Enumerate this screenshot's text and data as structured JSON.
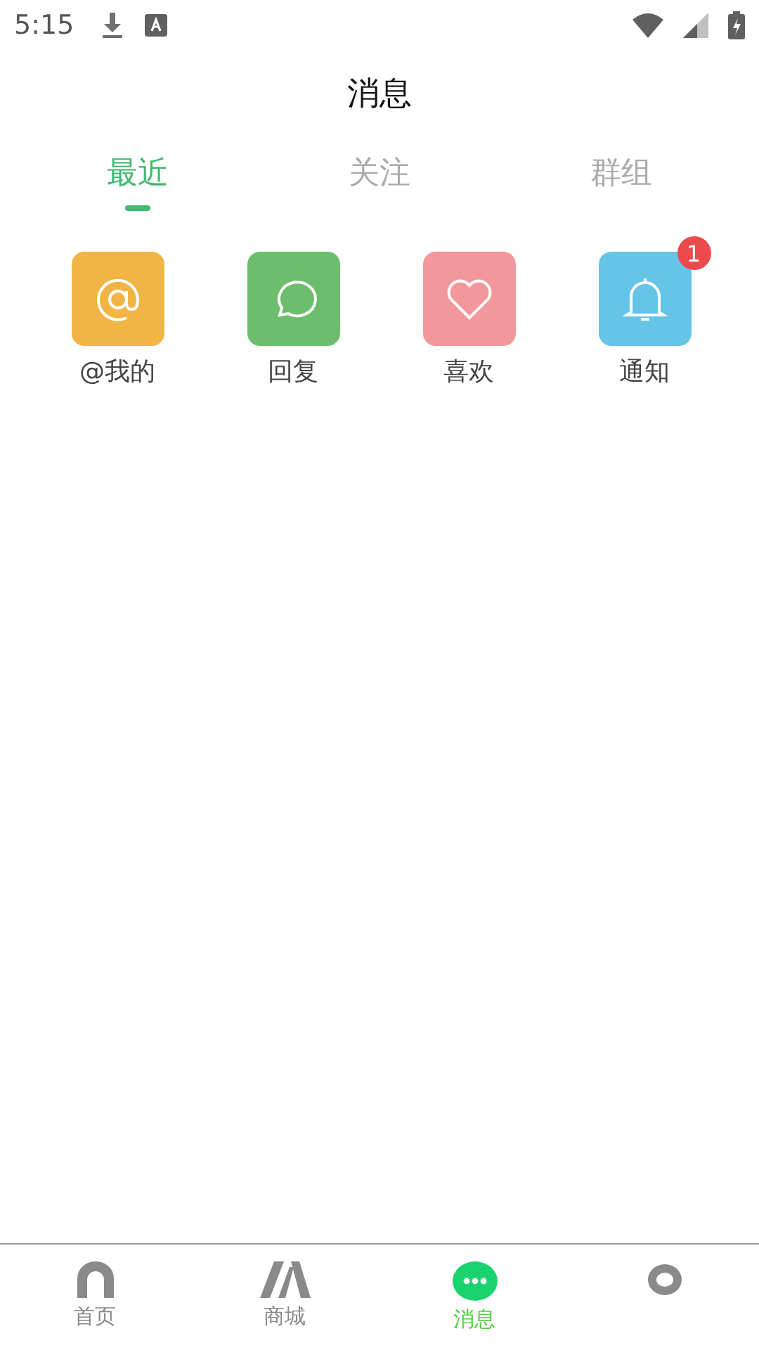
{
  "status_bar": {
    "time": "5:15"
  },
  "header": {
    "title": "消息"
  },
  "tabs": [
    {
      "label": "最近",
      "selected": true
    },
    {
      "label": "关注",
      "selected": false
    },
    {
      "label": "群组",
      "selected": false
    }
  ],
  "categories": [
    {
      "kind": "mention",
      "label": "@我的",
      "color": "#f0b545"
    },
    {
      "kind": "reply",
      "label": "回复",
      "color": "#6dbe6c"
    },
    {
      "kind": "like",
      "label": "喜欢",
      "color": "#f2989c"
    },
    {
      "kind": "notice",
      "label": "通知",
      "color": "#66c4e6",
      "badge": "1"
    }
  ],
  "bottom_nav": [
    {
      "label": "首页",
      "selected": false
    },
    {
      "label": "商城",
      "selected": false
    },
    {
      "label": "消息",
      "selected": true
    },
    {
      "selected": false
    }
  ]
}
